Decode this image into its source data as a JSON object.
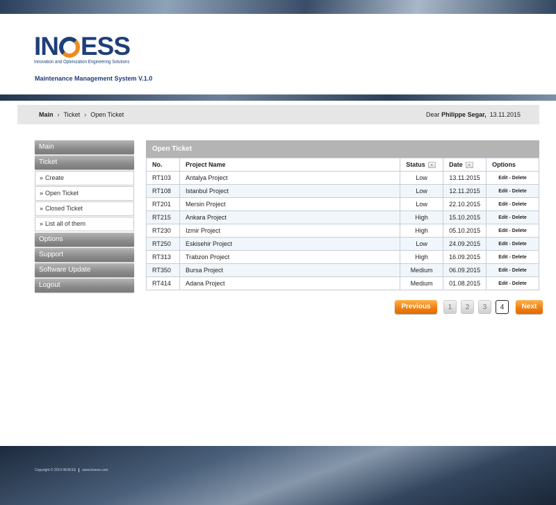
{
  "brand": {
    "name_before": "IN",
    "name_after": "ESS",
    "tagline": "Innovation and Optimization Engineering Solutions",
    "system_title": "Maintenance Management System V.1.0",
    "colors": {
      "primary": "#1e3f7a",
      "accent": "#f08a1c"
    }
  },
  "breadcrumb": {
    "items": [
      "Main",
      "Ticket",
      "Open Ticket"
    ],
    "separator": "›",
    "greeting": "Dear",
    "user": "Philippe Segar,",
    "date": "13.11.2015"
  },
  "sidebar": {
    "items": [
      {
        "label": "Main"
      },
      {
        "label": "Ticket"
      }
    ],
    "submenu": [
      {
        "label": "Create"
      },
      {
        "label": "Open Ticket"
      },
      {
        "label": "Closed Ticket"
      },
      {
        "label": "List all of them"
      }
    ],
    "submenu_arrow": "»",
    "items_after": [
      {
        "label": "Options"
      },
      {
        "label": "Support"
      },
      {
        "label": "Software Update"
      },
      {
        "label": "Logout"
      }
    ]
  },
  "panel": {
    "title": "Open Ticket",
    "columns": {
      "no": "No.",
      "project": "Project Name",
      "status": "Status",
      "date": "Date",
      "options": "Options"
    },
    "sort_icon": "⌄",
    "option_edit": "Edit",
    "option_sep": "-",
    "option_delete": "Delete",
    "rows": [
      {
        "no": "RT103",
        "project": "Antalya Project",
        "status": "Low",
        "date": "13.11.2015"
      },
      {
        "no": "RT108",
        "project": "Istanbul Project",
        "status": "Low",
        "date": "12.11.2015"
      },
      {
        "no": "RT201",
        "project": "Mersin Project",
        "status": "Low",
        "date": "22.10.2015"
      },
      {
        "no": "RT215",
        "project": "Ankara Project",
        "status": "High",
        "date": "15.10.2015"
      },
      {
        "no": "RT230",
        "project": "Izmir Project",
        "status": "High",
        "date": "05.10.2015"
      },
      {
        "no": "RT250",
        "project": "Eskisehir Project",
        "status": "Low",
        "date": "24.09.2015"
      },
      {
        "no": "RT313",
        "project": "Trabzon Project",
        "status": "High",
        "date": "16.09.2015"
      },
      {
        "no": "RT350",
        "project": "Bursa Project",
        "status": "Medium",
        "date": "06.09.2015"
      },
      {
        "no": "RT414",
        "project": "Adana Project",
        "status": "Medium",
        "date": "01.08.2015"
      }
    ]
  },
  "pagination": {
    "previous": "Previous",
    "next": "Next",
    "pages": [
      "1",
      "2",
      "3",
      "4"
    ],
    "current": "4"
  },
  "footer": {
    "copyright": "Copyright © 2014 INOESS",
    "website": "www.inoess.com"
  }
}
